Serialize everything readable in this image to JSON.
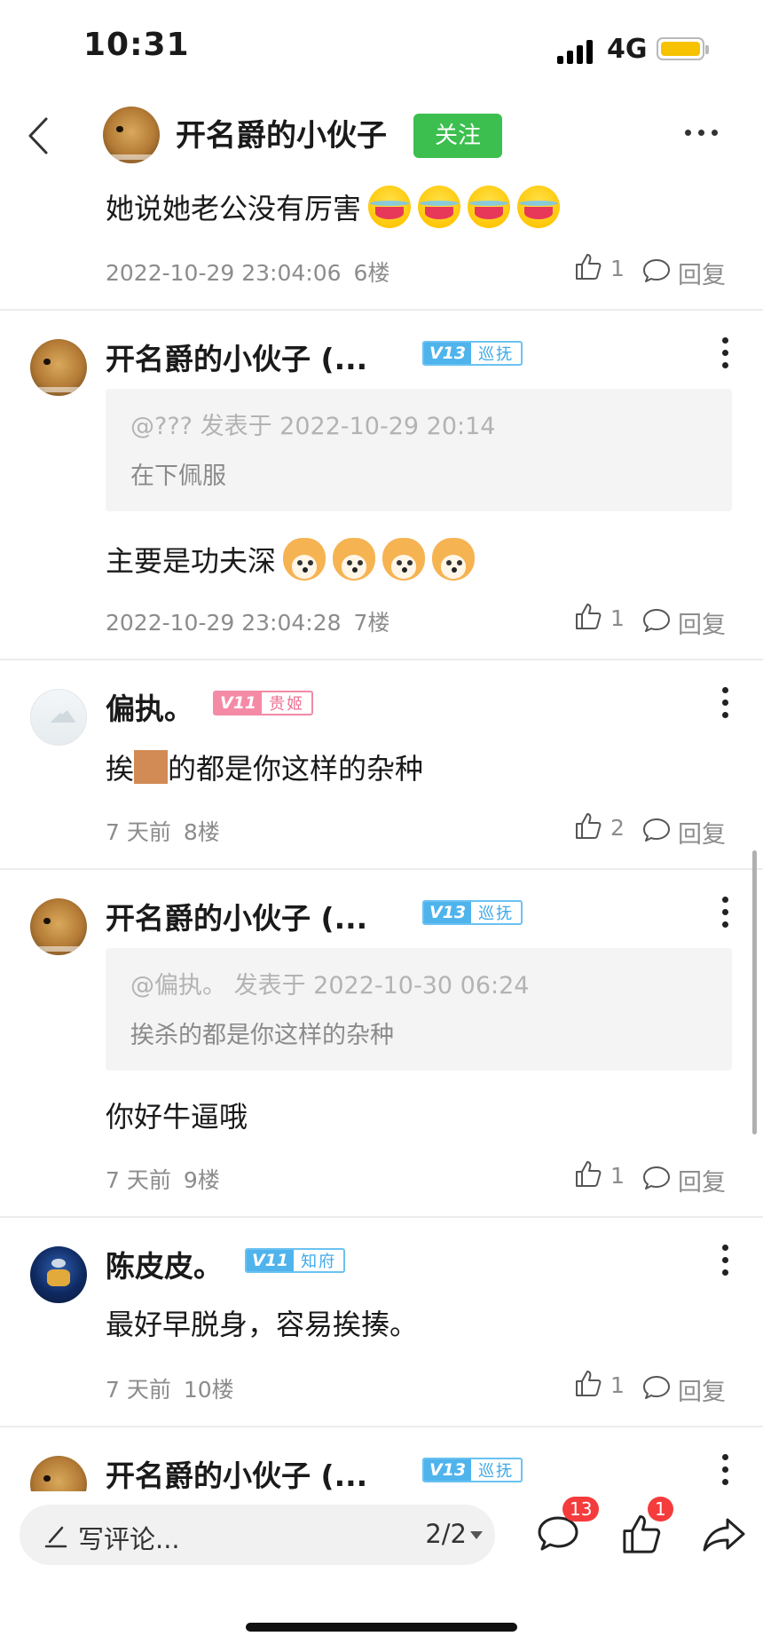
{
  "status_bar": {
    "time": "10:31",
    "network": "4G"
  },
  "header": {
    "poster_name": "开名爵的小伙子",
    "follow_label": "关注"
  },
  "comments": [
    {
      "text": "她说她老公没有厉害",
      "emoji_icon": "laughing-tears-emoji",
      "time": "2022-10-29 23:04:06",
      "floor": "6楼",
      "likes": "1",
      "reply_label": "回复"
    },
    {
      "name": "开名爵的小伙子 (...",
      "badge": {
        "level": "V13",
        "title": "巡抚",
        "color": "#4fb3ec"
      },
      "quote": {
        "meta": "@??? 发表于 2022-10-29 20:14",
        "text": "在下佩服"
      },
      "text": "主要是功夫深",
      "emoji_icon": "shiba-dog-emoji",
      "time": "2022-10-29 23:04:28",
      "floor": "7楼",
      "likes": "1",
      "reply_label": "回复"
    },
    {
      "name": "偏执。",
      "badge": {
        "level": "V11",
        "title": "贵姬",
        "color": "#f58aa6"
      },
      "text_before": "挨",
      "text_after": "的都是你这样的杂种",
      "time": "7 天前",
      "floor": "8楼",
      "likes": "2",
      "reply_label": "回复"
    },
    {
      "name": "开名爵的小伙子 (...",
      "badge": {
        "level": "V13",
        "title": "巡抚",
        "color": "#4fb3ec"
      },
      "quote": {
        "meta": "@偏执。 发表于 2022-10-30 06:24",
        "text": "挨杀的都是你这样的杂种"
      },
      "text": "你好牛逼哦",
      "time": "7 天前",
      "floor": "9楼",
      "likes": "1",
      "reply_label": "回复"
    },
    {
      "name": "陈皮皮。",
      "badge": {
        "level": "V11",
        "title": "知府",
        "color": "#4fb3ec"
      },
      "text": "最好早脱身，容易挨揍。",
      "time": "7 天前",
      "floor": "10楼",
      "likes": "1",
      "reply_label": "回复"
    },
    {
      "name": "开名爵的小伙子 (...",
      "badge": {
        "level": "V13",
        "title": "巡抚",
        "color": "#4fb3ec"
      }
    }
  ],
  "bottom_bar": {
    "input_placeholder": "写评论...",
    "page_indicator": "2/2",
    "comment_count": "13",
    "like_count": "1"
  },
  "colors": {
    "follow_green": "#3cbf4f",
    "badge_red": "#f53c3c"
  }
}
